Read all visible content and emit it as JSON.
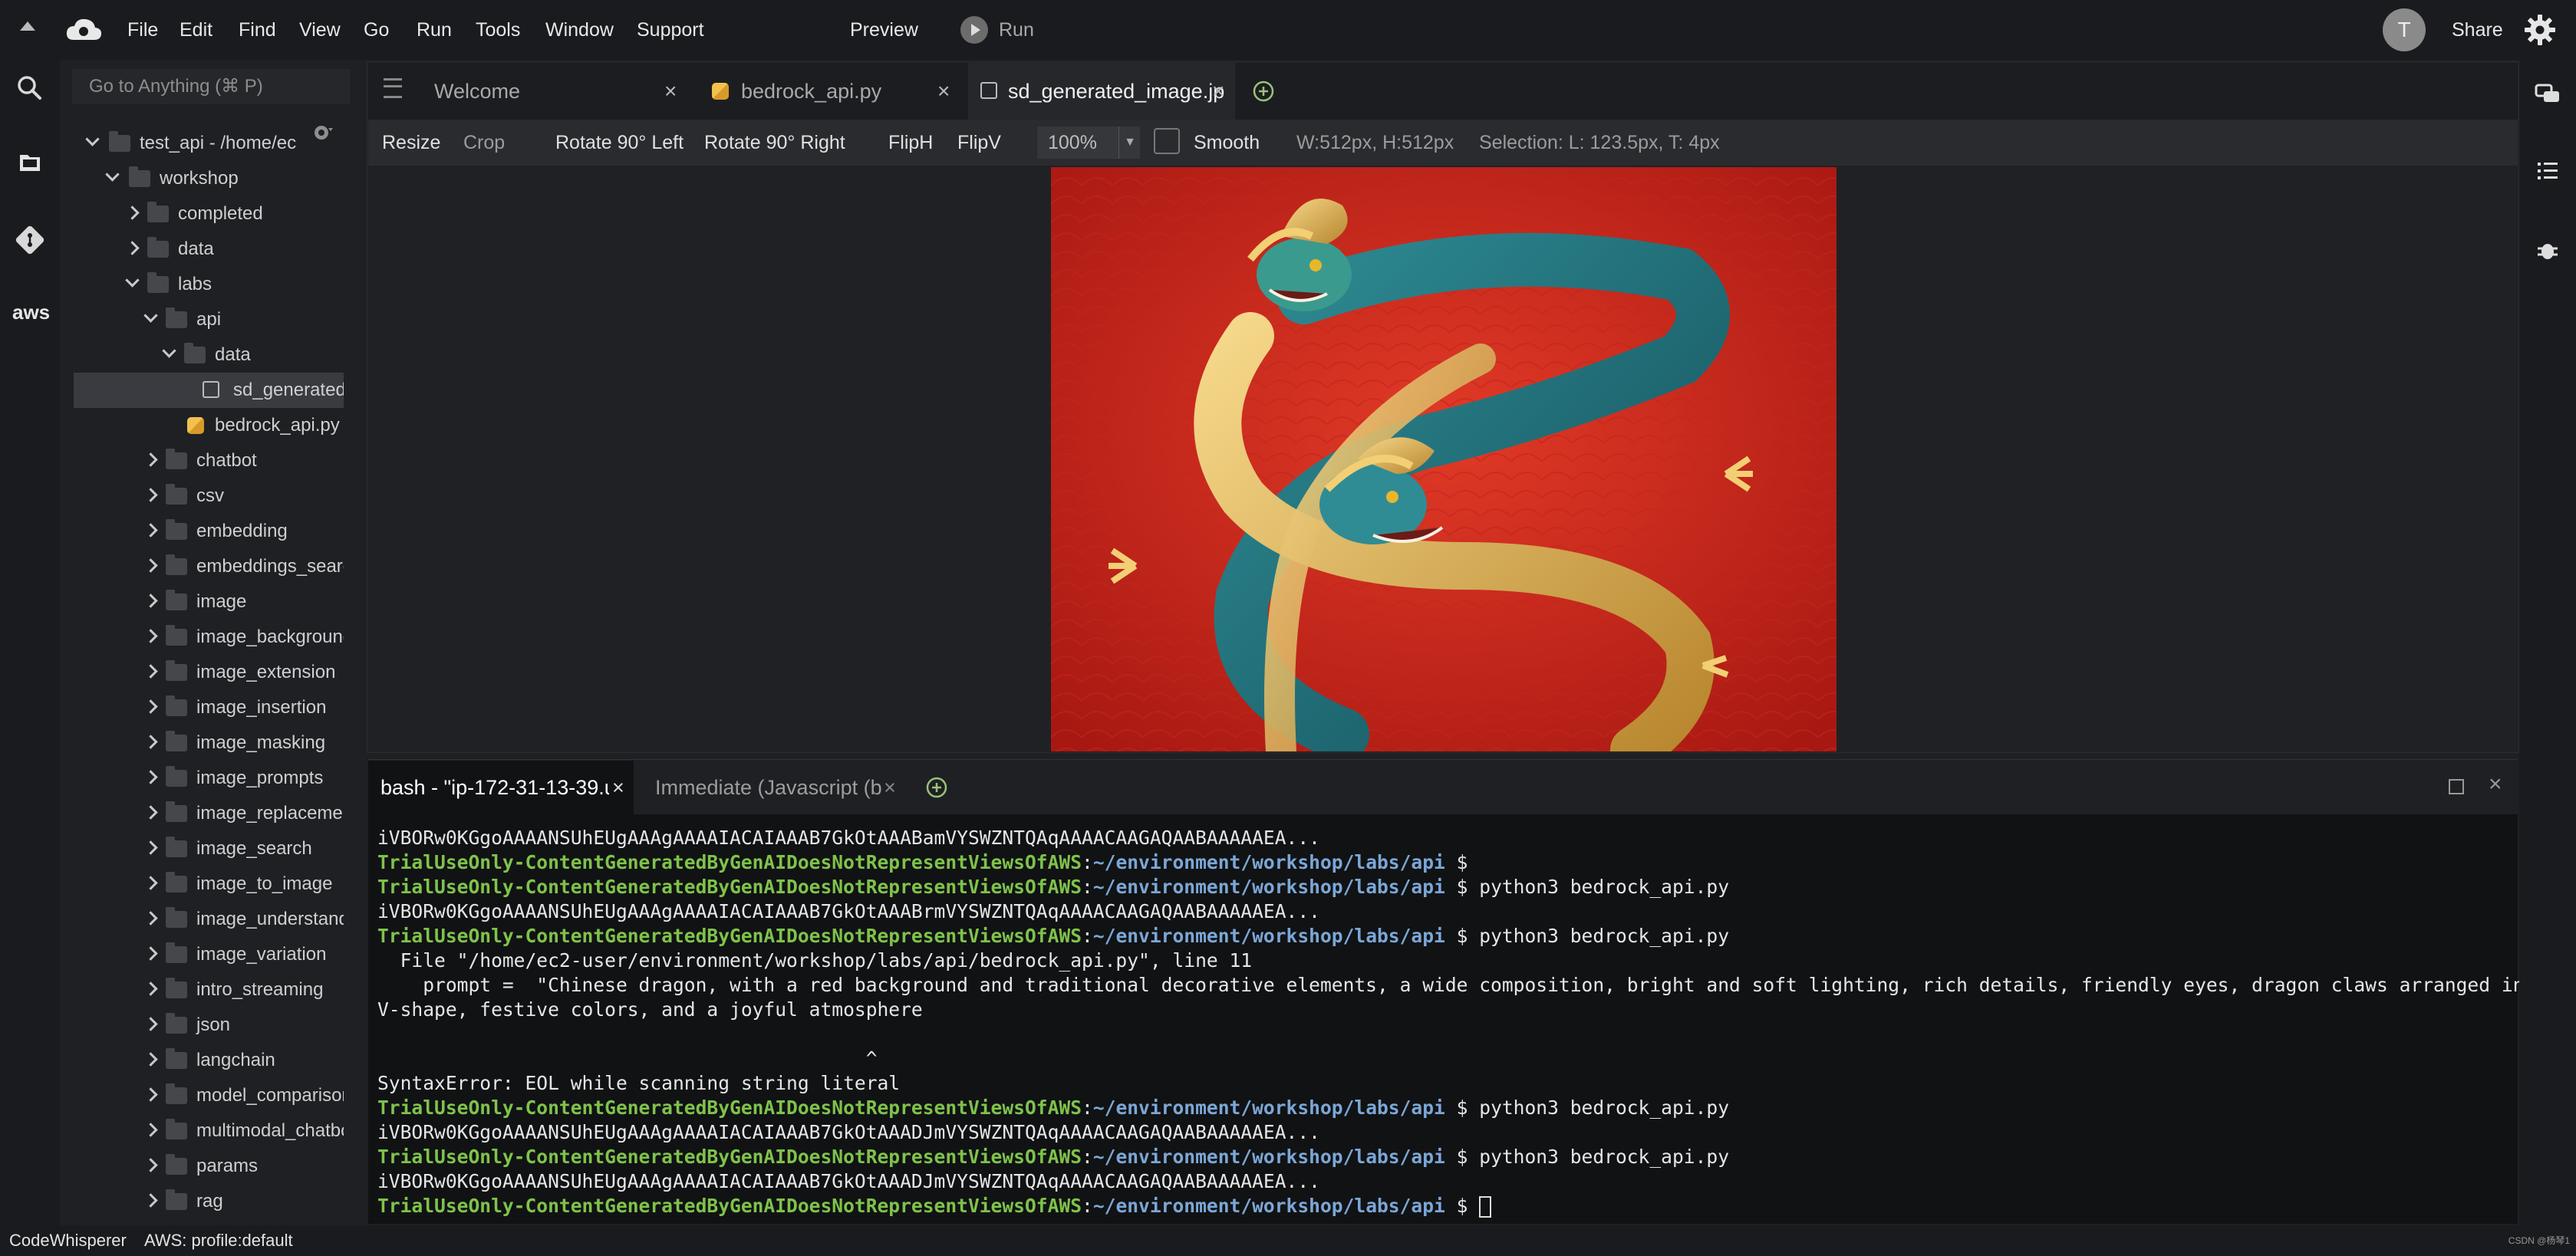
{
  "menu": {
    "items": [
      "File",
      "Edit",
      "Find",
      "View",
      "Go",
      "Run",
      "Tools",
      "Window",
      "Support"
    ],
    "preview": "Preview",
    "run": "Run",
    "avatar_letter": "T",
    "share": "Share"
  },
  "sidebar": {
    "goto_placeholder": "Go to Anything (⌘ P)",
    "tree": [
      {
        "label": "test_api - /home/ec",
        "type": "folder",
        "state": "open"
      },
      {
        "label": "workshop",
        "type": "folder",
        "state": "open"
      },
      {
        "label": "completed",
        "type": "folder",
        "state": "closed"
      },
      {
        "label": "data",
        "type": "folder",
        "state": "closed"
      },
      {
        "label": "labs",
        "type": "folder",
        "state": "open"
      },
      {
        "label": "api",
        "type": "folder",
        "state": "open"
      },
      {
        "label": "data",
        "type": "folder",
        "state": "open"
      },
      {
        "label": "sd_generated_image.jpg",
        "type": "image",
        "selected": true
      },
      {
        "label": "bedrock_api.py",
        "type": "python"
      },
      {
        "label": "chatbot",
        "type": "folder",
        "state": "closed"
      },
      {
        "label": "csv",
        "type": "folder",
        "state": "closed"
      },
      {
        "label": "embedding",
        "type": "folder",
        "state": "closed"
      },
      {
        "label": "embeddings_search",
        "type": "folder",
        "state": "closed"
      },
      {
        "label": "image",
        "type": "folder",
        "state": "closed"
      },
      {
        "label": "image_background",
        "type": "folder",
        "state": "closed"
      },
      {
        "label": "image_extension",
        "type": "folder",
        "state": "closed"
      },
      {
        "label": "image_insertion",
        "type": "folder",
        "state": "closed"
      },
      {
        "label": "image_masking",
        "type": "folder",
        "state": "closed"
      },
      {
        "label": "image_prompts",
        "type": "folder",
        "state": "closed"
      },
      {
        "label": "image_replacement",
        "type": "folder",
        "state": "closed"
      },
      {
        "label": "image_search",
        "type": "folder",
        "state": "closed"
      },
      {
        "label": "image_to_image",
        "type": "folder",
        "state": "closed"
      },
      {
        "label": "image_understanding",
        "type": "folder",
        "state": "closed"
      },
      {
        "label": "image_variation",
        "type": "folder",
        "state": "closed"
      },
      {
        "label": "intro_streaming",
        "type": "folder",
        "state": "closed"
      },
      {
        "label": "json",
        "type": "folder",
        "state": "closed"
      },
      {
        "label": "langchain",
        "type": "folder",
        "state": "closed"
      },
      {
        "label": "model_comparison",
        "type": "folder",
        "state": "closed"
      },
      {
        "label": "multimodal_chatbot",
        "type": "folder",
        "state": "closed"
      },
      {
        "label": "params",
        "type": "folder",
        "state": "closed"
      },
      {
        "label": "rag",
        "type": "folder",
        "state": "closed"
      }
    ]
  },
  "editor": {
    "tabs": [
      {
        "label": "Welcome",
        "icon": "none",
        "active": false
      },
      {
        "label": "bedrock_api.py",
        "icon": "python-icon",
        "active": false
      },
      {
        "label": "sd_generated_image.jp",
        "icon": "image-icon",
        "active": true
      }
    ],
    "toolbar": {
      "resize": "Resize",
      "crop": "Crop",
      "rotate_left": "Rotate 90° Left",
      "rotate_right": "Rotate 90° Right",
      "fliph": "FlipH",
      "flipv": "FlipV",
      "zoom": "100%",
      "smooth": "Smooth",
      "dimensions": "W:512px, H:512px",
      "selection": "Selection:  L: 123.5px, T: 4px"
    }
  },
  "terminal": {
    "tabs": [
      {
        "label": "bash - \"ip-172-31-13-39.u",
        "active": true
      },
      {
        "label": "Immediate (Javascript (bro",
        "active": false
      }
    ],
    "prompt_user": "TrialUseOnly-ContentGeneratedByGenAIDoesNotRepresentViewsOfAWS",
    "prompt_path": "~/environment/workshop/labs/api",
    "lines": [
      {
        "kind": "out",
        "text": "iVBORw0KGgoAAAANSUhEUgAAAgAAAAIACAIAAAB7GkOtAAABamVYSWZNTQAqAAAACAAGAQAABAAAAAEA..."
      },
      {
        "kind": "prompt",
        "cmd": ""
      },
      {
        "kind": "prompt",
        "cmd": "python3 bedrock_api.py"
      },
      {
        "kind": "out",
        "text": "iVBORw0KGgoAAAANSUhEUgAAAgAAAAIACAIAAAB7GkOtAAABrmVYSWZNTQAqAAAACAAGAQAABAAAAAEA..."
      },
      {
        "kind": "prompt",
        "cmd": "python3 bedrock_api.py"
      },
      {
        "kind": "out",
        "text": "  File \"/home/ec2-user/environment/workshop/labs/api/bedrock_api.py\", line 11"
      },
      {
        "kind": "out",
        "text": "    prompt =  \"Chinese dragon, with a red background and traditional decorative elements, a wide composition, bright and soft lighting, rich details, friendly eyes, dragon claws arranged in a"
      },
      {
        "kind": "out",
        "text": "V-shape, festive colors, and a joyful atmosphere"
      },
      {
        "kind": "out",
        "text": ""
      },
      {
        "kind": "out",
        "text": "                                           ^"
      },
      {
        "kind": "out",
        "text": "SyntaxError: EOL while scanning string literal"
      },
      {
        "kind": "prompt",
        "cmd": "python3 bedrock_api.py"
      },
      {
        "kind": "out",
        "text": "iVBORw0KGgoAAAANSUhEUgAAAgAAAAIACAIAAAB7GkOtAAADJmVYSWZNTQAqAAAACAAGAQAABAAAAAEA..."
      },
      {
        "kind": "prompt",
        "cmd": "python3 bedrock_api.py"
      },
      {
        "kind": "out",
        "text": "iVBORw0KGgoAAAANSUhEUgAAAgAAAAIACAIAAAB7GkOtAAADJmVYSWZNTQAqAAAACAAGAQAABAAAAAEA..."
      },
      {
        "kind": "prompt_cursor",
        "cmd": ""
      }
    ]
  },
  "status": {
    "codewhisperer": "CodeWhisperer",
    "aws_profile": "AWS: profile:default",
    "watermark": "CSDN @杨琴1"
  },
  "rail": {
    "aws": "aws"
  },
  "colors": {
    "prompt_user": "#7ec34a",
    "prompt_path": "#7ba7d6",
    "dragon_bg": "#c9251c"
  }
}
